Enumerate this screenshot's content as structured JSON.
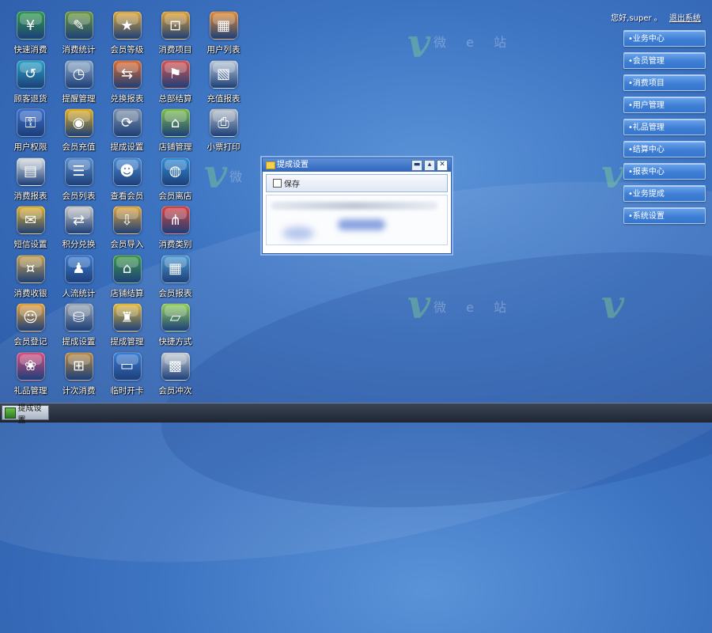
{
  "desktop": {
    "icons": [
      {
        "label": "快速消费",
        "icon": "cash-register-icon",
        "color": "#2f9b4a"
      },
      {
        "label": "顾客退货",
        "icon": "return-arrow-icon",
        "color": "#27a3c8"
      },
      {
        "label": "用户权限",
        "icon": "user-lock-icon",
        "color": "#3a6fcf"
      },
      {
        "label": "消费报表",
        "icon": "report-chart-icon",
        "color": "#d8dde3"
      },
      {
        "label": "短信设置",
        "icon": "envelope-gear-icon",
        "color": "#e3b32a"
      },
      {
        "label": "消费收银",
        "icon": "cashier-icon",
        "color": "#c9a24c"
      },
      {
        "label": "会员登记",
        "icon": "member-register-icon",
        "color": "#e5a23b"
      },
      {
        "label": "礼品管理",
        "icon": "gift-icon",
        "color": "#d84f7f"
      },
      {
        "label": "消费统计",
        "icon": "statistics-pen-icon",
        "color": "#6b9a3a"
      },
      {
        "label": "提醒管理",
        "icon": "monitor-clock-icon",
        "color": "#8aa8c9"
      },
      {
        "label": "会员充值",
        "icon": "coins-icon",
        "color": "#e2b020"
      },
      {
        "label": "会员列表",
        "icon": "member-list-icon",
        "color": "#5a8fd0"
      },
      {
        "label": "积分兑换",
        "icon": "points-exchange-icon",
        "color": "#c8c8c8"
      },
      {
        "label": "人流统计",
        "icon": "people-group-icon",
        "color": "#3b7bd3"
      },
      {
        "label": "提成设置",
        "icon": "database-gear-icon",
        "color": "#9ba7b5"
      },
      {
        "label": "计次消费",
        "icon": "count-consume-icon",
        "color": "#b88b45"
      },
      {
        "label": "会员等级",
        "icon": "member-level-icon",
        "color": "#e0a836"
      },
      {
        "label": "兑换报表",
        "icon": "exchange-report-icon",
        "color": "#e06a2b"
      },
      {
        "label": "提成设置",
        "icon": "database-refresh-icon",
        "color": "#7f93ab"
      },
      {
        "label": "查看会员",
        "icon": "view-member-icon",
        "color": "#4b8cd6"
      },
      {
        "label": "会员导入",
        "icon": "member-import-icon",
        "color": "#e2a63a"
      },
      {
        "label": "店铺结算",
        "icon": "shop-settle-icon",
        "color": "#3d9a47"
      },
      {
        "label": "提成管理",
        "icon": "user-commission-icon",
        "color": "#e5b93a"
      },
      {
        "label": "临时开卡",
        "icon": "temp-card-icon",
        "color": "#3a7dd6"
      },
      {
        "label": "消费项目",
        "icon": "shopping-basket-icon",
        "color": "#e3a12c"
      },
      {
        "label": "总部结算",
        "icon": "hq-settle-icon",
        "color": "#d9534f"
      },
      {
        "label": "店铺管理",
        "icon": "shop-manage-icon",
        "color": "#7bbf4a"
      },
      {
        "label": "会员离店",
        "icon": "globe-member-icon",
        "color": "#2f8ed8"
      },
      {
        "label": "消费类别",
        "icon": "network-tree-icon",
        "color": "#d94040"
      },
      {
        "label": "会员报表",
        "icon": "member-report-icon",
        "color": "#4c9bd6"
      },
      {
        "label": "快捷方式",
        "icon": "folder-shortcut-icon",
        "color": "#8fcf5a"
      },
      {
        "label": "会员冲次",
        "icon": "calculator-plus-icon",
        "color": "#c7cdd4"
      },
      {
        "label": "用户列表",
        "icon": "user-grid-icon",
        "color": "#e58a2f"
      },
      {
        "label": "充值报表",
        "icon": "recharge-report-icon",
        "color": "#b8c7d8"
      },
      {
        "label": "小票打印",
        "icon": "printer-icon",
        "color": "#b9c2cc"
      }
    ]
  },
  "topbar": {
    "greeting": "您好,super 。",
    "logout": "退出系统"
  },
  "right_menu": [
    "•业务中心",
    "•会员管理",
    "•消费项目",
    "•用户管理",
    "•礼品管理",
    "•结算中心",
    "•报表中心",
    "•业务提成",
    "•系统设置"
  ],
  "dialog": {
    "title": "提成设置",
    "minimize": "▬",
    "restore": "▴",
    "close": "✕",
    "save_label": "保存"
  },
  "taskbar": {
    "item_label": "提成设置"
  },
  "watermark": {
    "glyph": "v",
    "text": "微 e 站"
  }
}
